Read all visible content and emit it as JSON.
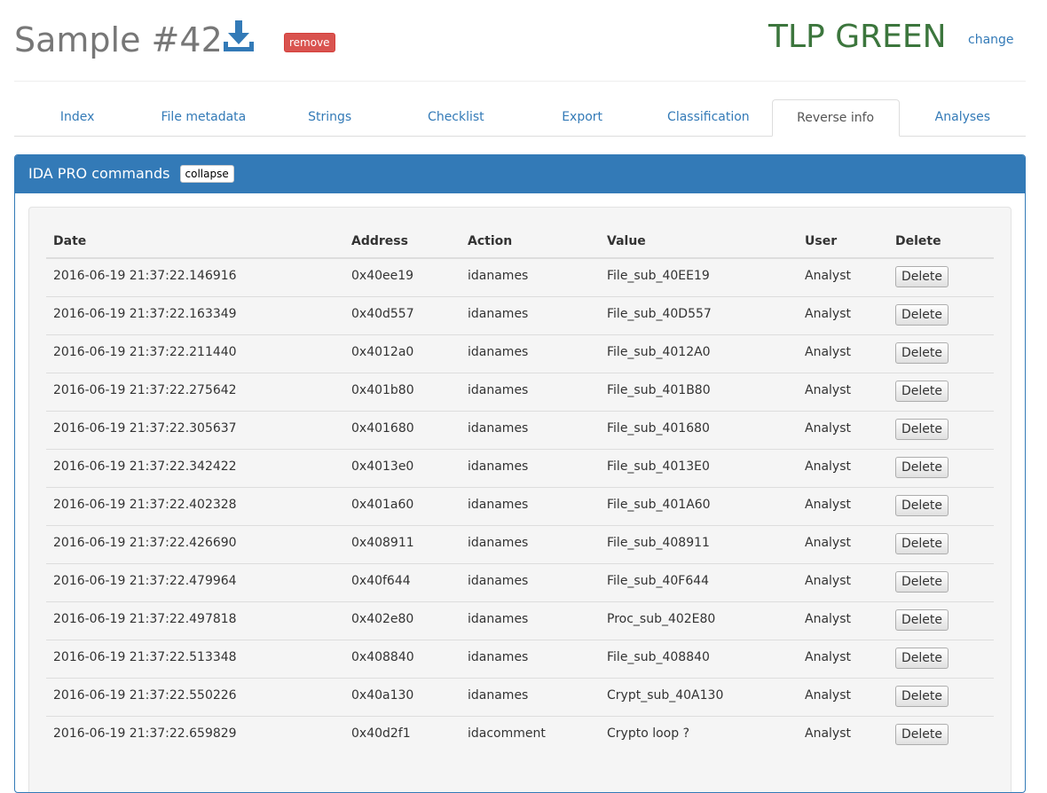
{
  "header": {
    "title": "Sample #42",
    "download_icon": "download-icon",
    "remove_label": "remove",
    "tlp_label": "TLP GREEN",
    "tlp_color": "#3c763d",
    "change_label": "change"
  },
  "tabs": [
    {
      "label": "Index",
      "active": false
    },
    {
      "label": "File metadata",
      "active": false
    },
    {
      "label": "Strings",
      "active": false
    },
    {
      "label": "Checklist",
      "active": false
    },
    {
      "label": "Export",
      "active": false
    },
    {
      "label": "Classification",
      "active": false
    },
    {
      "label": "Reverse info",
      "active": true
    },
    {
      "label": "Analyses",
      "active": false
    }
  ],
  "panel": {
    "title": "IDA PRO commands",
    "collapse_label": "collapse",
    "accent_color": "#337ab7"
  },
  "table": {
    "columns": [
      "Date",
      "Address",
      "Action",
      "Value",
      "User",
      "Delete"
    ],
    "delete_label": "Delete",
    "rows": [
      {
        "date": "2016-06-19 21:37:22.146916",
        "address": "0x40ee19",
        "action": "idanames",
        "value": "File_sub_40EE19",
        "user": "Analyst"
      },
      {
        "date": "2016-06-19 21:37:22.163349",
        "address": "0x40d557",
        "action": "idanames",
        "value": "File_sub_40D557",
        "user": "Analyst"
      },
      {
        "date": "2016-06-19 21:37:22.211440",
        "address": "0x4012a0",
        "action": "idanames",
        "value": "File_sub_4012A0",
        "user": "Analyst"
      },
      {
        "date": "2016-06-19 21:37:22.275642",
        "address": "0x401b80",
        "action": "idanames",
        "value": "File_sub_401B80",
        "user": "Analyst"
      },
      {
        "date": "2016-06-19 21:37:22.305637",
        "address": "0x401680",
        "action": "idanames",
        "value": "File_sub_401680",
        "user": "Analyst"
      },
      {
        "date": "2016-06-19 21:37:22.342422",
        "address": "0x4013e0",
        "action": "idanames",
        "value": "File_sub_4013E0",
        "user": "Analyst"
      },
      {
        "date": "2016-06-19 21:37:22.402328",
        "address": "0x401a60",
        "action": "idanames",
        "value": "File_sub_401A60",
        "user": "Analyst"
      },
      {
        "date": "2016-06-19 21:37:22.426690",
        "address": "0x408911",
        "action": "idanames",
        "value": "File_sub_408911",
        "user": "Analyst"
      },
      {
        "date": "2016-06-19 21:37:22.479964",
        "address": "0x40f644",
        "action": "idanames",
        "value": "File_sub_40F644",
        "user": "Analyst"
      },
      {
        "date": "2016-06-19 21:37:22.497818",
        "address": "0x402e80",
        "action": "idanames",
        "value": "Proc_sub_402E80",
        "user": "Analyst"
      },
      {
        "date": "2016-06-19 21:37:22.513348",
        "address": "0x408840",
        "action": "idanames",
        "value": "File_sub_408840",
        "user": "Analyst"
      },
      {
        "date": "2016-06-19 21:37:22.550226",
        "address": "0x40a130",
        "action": "idanames",
        "value": "Crypt_sub_40A130",
        "user": "Analyst"
      },
      {
        "date": "2016-06-19 21:37:22.659829",
        "address": "0x40d2f1",
        "action": "idacomment",
        "value": "Crypto loop ?",
        "user": "Analyst"
      }
    ]
  }
}
